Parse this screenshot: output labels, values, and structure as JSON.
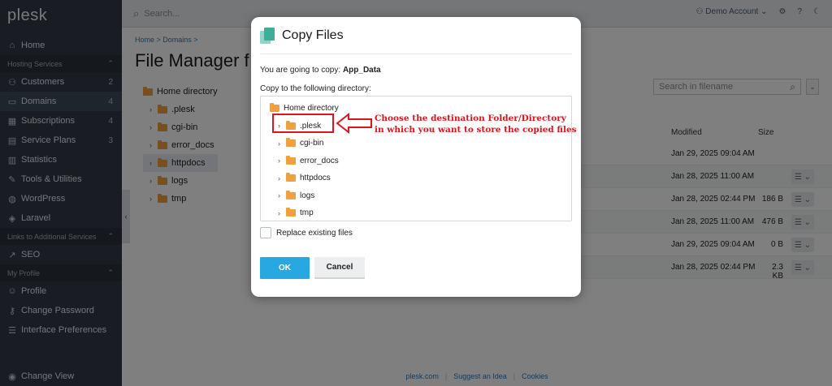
{
  "sidebar": {
    "logo": "plesk",
    "items": [
      {
        "type": "item",
        "icon": "home-icon",
        "label": "Home",
        "count": ""
      },
      {
        "type": "section",
        "label": "Hosting Services"
      },
      {
        "type": "item",
        "icon": "user-icon",
        "label": "Customers",
        "count": "2"
      },
      {
        "type": "item",
        "icon": "monitor-icon",
        "label": "Domains",
        "count": "4",
        "active": true
      },
      {
        "type": "item",
        "icon": "grid-icon",
        "label": "Subscriptions",
        "count": "4"
      },
      {
        "type": "item",
        "icon": "book-icon",
        "label": "Service Plans",
        "count": "3"
      },
      {
        "type": "item",
        "icon": "chart-icon",
        "label": "Statistics",
        "count": ""
      },
      {
        "type": "item",
        "icon": "wrench-icon",
        "label": "Tools & Utilities",
        "count": ""
      },
      {
        "type": "item",
        "icon": "wordpress-icon",
        "label": "WordPress",
        "count": ""
      },
      {
        "type": "item",
        "icon": "laravel-icon",
        "label": "Laravel",
        "count": ""
      },
      {
        "type": "section",
        "label": "Links to Additional Services"
      },
      {
        "type": "item",
        "icon": "seo-icon",
        "label": "SEO",
        "count": ""
      },
      {
        "type": "section",
        "label": "My Profile"
      },
      {
        "type": "item",
        "icon": "profile-icon",
        "label": "Profile",
        "count": ""
      },
      {
        "type": "item",
        "icon": "key-icon",
        "label": "Change Password",
        "count": ""
      },
      {
        "type": "item",
        "icon": "list-icon",
        "label": "Interface Preferences",
        "count": ""
      }
    ],
    "change_view": "Change View"
  },
  "topbar": {
    "search_placeholder": "Search...",
    "account": "Demo Account"
  },
  "main": {
    "breadcrumb": "Home  >  Domains  >",
    "title": "File Manager f",
    "tree": [
      {
        "label": "Home directory",
        "level": 0
      },
      {
        "label": ".plesk",
        "level": 1
      },
      {
        "label": "cgi-bin",
        "level": 1
      },
      {
        "label": "error_docs",
        "level": 1
      },
      {
        "label": "httpdocs",
        "level": 1,
        "selected": true
      },
      {
        "label": "logs",
        "level": 1
      },
      {
        "label": "tmp",
        "level": 1
      }
    ],
    "file_search_placeholder": "Search in filename",
    "col_modified": "Modified",
    "col_size": "Size",
    "rows": [
      {
        "modified": "Jan 29, 2025 09:04 AM",
        "size": "",
        "menu": false
      },
      {
        "modified": "Jan 28, 2025 11:00 AM",
        "size": "",
        "menu": true
      },
      {
        "modified": "Jan 28, 2025 02:44 PM",
        "size": "186 B",
        "menu": true
      },
      {
        "modified": "Jan 28, 2025 11:00 AM",
        "size": "476 B",
        "menu": true
      },
      {
        "modified": "Jan 29, 2025 09:04 AM",
        "size": "0 B",
        "menu": true
      },
      {
        "modified": "Jan 28, 2025 02:44 PM",
        "size": "2.3 KB",
        "menu": true
      }
    ],
    "footer": [
      "plesk.com",
      "Suggest an Idea",
      "Cookies"
    ]
  },
  "modal": {
    "title": "Copy Files",
    "going_prefix": "You are going to copy:",
    "going_item": "App_Data",
    "copy_to_label": "Copy to the following directory:",
    "tree": [
      {
        "label": "Home directory",
        "level": 0
      },
      {
        "label": ".plesk",
        "level": 1
      },
      {
        "label": "cgi-bin",
        "level": 1
      },
      {
        "label": "error_docs",
        "level": 1
      },
      {
        "label": "httpdocs",
        "level": 1
      },
      {
        "label": "logs",
        "level": 1
      },
      {
        "label": "tmp",
        "level": 1
      }
    ],
    "annotation_line1": "Choose the destination Folder/Directory",
    "annotation_line2": "in which you want to store the copied files",
    "replace_label": "Replace existing files",
    "ok_label": "OK",
    "cancel_label": "Cancel",
    "annotation_color": "#e0141e"
  },
  "colors": {
    "sidebar_bg": "#323a47",
    "accent": "#28a8e0",
    "folder": "#f0a040"
  }
}
